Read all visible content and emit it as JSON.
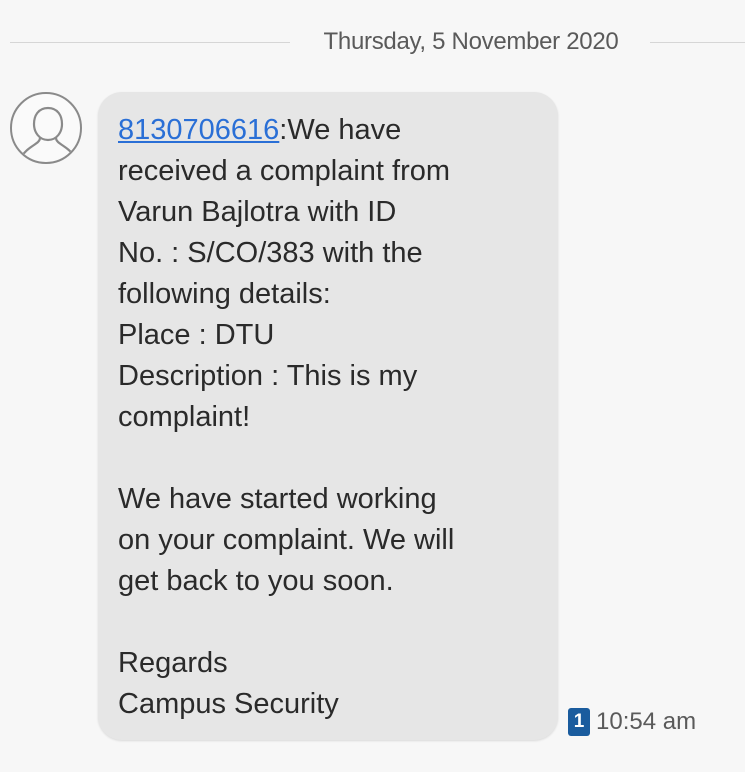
{
  "date_divider": {
    "text": "Thursday, 5 November 2020"
  },
  "contact": {
    "avatar_icon": "person-outline-icon"
  },
  "message": {
    "sender_number": "8130706616",
    "body": ":We have\nreceived a complaint from\nVarun Bajlotra with ID\nNo. : S/CO/383 with the\nfollowing details:\nPlace : DTU\nDescription : This is my\ncomplaint!\n\nWe have started working\non your complaint. We will\nget back to you soon.\n\nRegards\nCampus Security",
    "sim_slot": "1",
    "time": "10:54 am"
  },
  "colors": {
    "background": "#f7f7f7",
    "bubble": "#e6e6e6",
    "link": "#2a6fd6",
    "sim_badge": "#1a5c9e",
    "meta_text": "#5a5a5a"
  }
}
